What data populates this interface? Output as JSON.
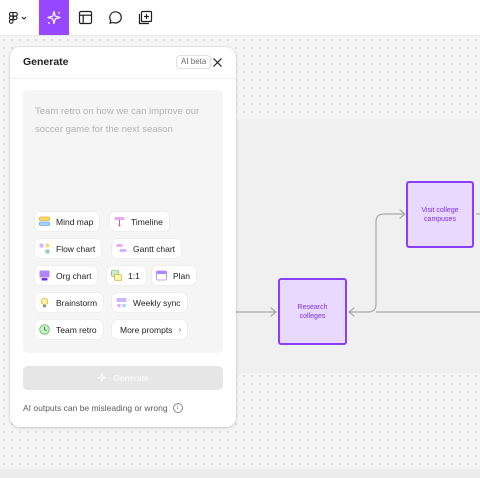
{
  "toolbar": {
    "tools": [
      "figma-menu",
      "ai-sparkle",
      "frame",
      "comment",
      "add-section"
    ],
    "active_tool": "ai-sparkle",
    "accent_color": "#9747ff"
  },
  "panel": {
    "title": "Generate",
    "badge": "AI beta",
    "prompt_placeholder": "Team retro on how we can improve our soccer game for the next season",
    "templates": [
      {
        "label": "Mind map",
        "icon": "mind-map-icon"
      },
      {
        "label": "Timeline",
        "icon": "timeline-icon"
      },
      {
        "label": "Flow chart",
        "icon": "flow-chart-icon"
      },
      {
        "label": "Gantt chart",
        "icon": "gantt-chart-icon"
      },
      {
        "label": "Org chart",
        "icon": "org-chart-icon"
      },
      {
        "label": "1:1",
        "icon": "one-on-one-icon"
      },
      {
        "label": "Plan",
        "icon": "plan-icon"
      },
      {
        "label": "Brainstorm",
        "icon": "brainstorm-icon"
      },
      {
        "label": "Weekly sync",
        "icon": "weekly-sync-icon"
      },
      {
        "label": "Team retro",
        "icon": "team-retro-icon"
      },
      {
        "label": "More prompts",
        "icon": "chevron-right-icon"
      }
    ],
    "generate_label": "Generate",
    "disclaimer": "AI outputs can be misleading or wrong"
  },
  "canvas": {
    "nodes": [
      {
        "label": "Visit college campuses"
      },
      {
        "label": "Research colleges"
      }
    ],
    "node_fill": "#ead9ff",
    "node_border": "#8a3ffc"
  }
}
